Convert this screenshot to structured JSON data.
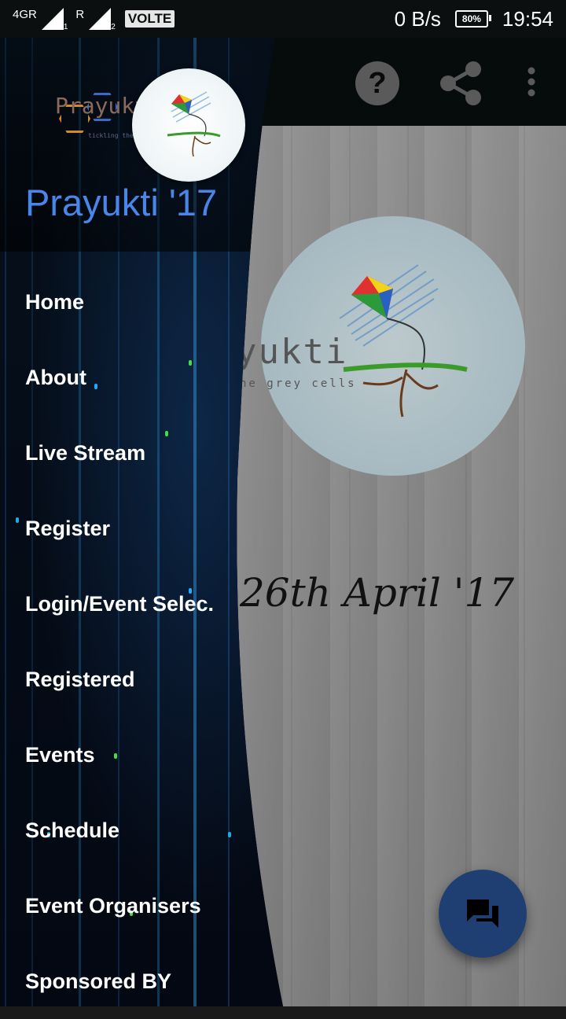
{
  "status_bar": {
    "network": "4GR",
    "sim1": "1",
    "r_label": "R",
    "sim2": "2",
    "volte": "VOLTE",
    "speed": "0 B/s",
    "battery": "80%",
    "time": "19:54"
  },
  "toolbar": {
    "help_glyph": "?",
    "icons": [
      "help-icon",
      "share-icon",
      "overflow-menu-icon"
    ]
  },
  "main": {
    "logo_text": "yukti",
    "logo_sub": "he grey cells",
    "date": "26th April '17",
    "fab_icon": "chat-icon"
  },
  "drawer": {
    "header_logo_text": "Prayukti",
    "header_logo_sub": "tickling the grey cells",
    "title": "Prayukti '17",
    "items": [
      {
        "label": "Home"
      },
      {
        "label": "About"
      },
      {
        "label": "Live Stream"
      },
      {
        "label": "Register"
      },
      {
        "label": "Login/Event Selec."
      },
      {
        "label": "Registered"
      },
      {
        "label": "Events"
      },
      {
        "label": "Schedule"
      },
      {
        "label": "Event Organisers"
      },
      {
        "label": "Sponsored BY"
      }
    ]
  },
  "colors": {
    "drawer_title": "#4a86e8",
    "fab": "#1f3f73",
    "status_bar": "#0b0f0f"
  }
}
